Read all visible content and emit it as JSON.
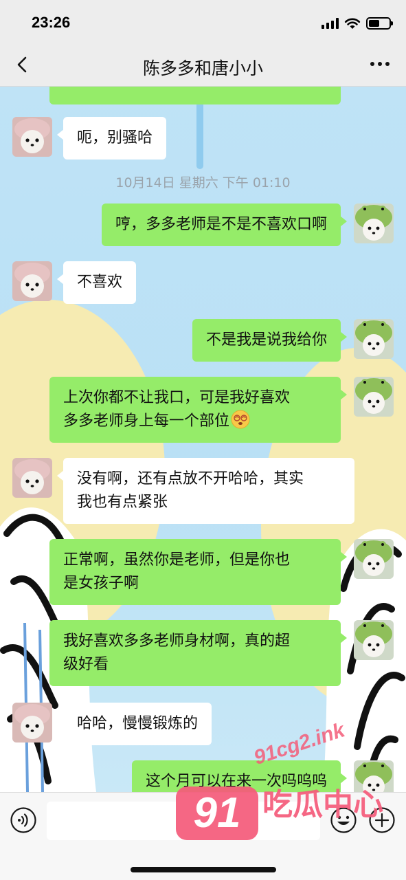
{
  "status_bar": {
    "time": "23:26",
    "battery_level": 0.55
  },
  "nav": {
    "title": "陈多多和唐小小"
  },
  "colors": {
    "outgoing_bubble": "#95ec69",
    "incoming_bubble": "#ffffff",
    "watermark": "#f45a7a"
  },
  "chat": {
    "timestamp": "10月14日 星期六 下午 01:10",
    "messages": [
      {
        "side": "in",
        "text": "呃，别骚哈"
      },
      {
        "side": "out",
        "text": "哼，多多老师是不是不喜欢口啊"
      },
      {
        "side": "in",
        "text": "不喜欢"
      },
      {
        "side": "out",
        "text": "不是我是说我给你"
      },
      {
        "side": "out",
        "line1": "上次你都不让我口，可是我好喜欢",
        "line2": "多多老师身上每一个部位",
        "emoji": "dizzy-face-emoji"
      },
      {
        "side": "in",
        "line1": "没有啊，还有点放不开哈哈，其实",
        "line2": "我也有点紧张"
      },
      {
        "side": "out",
        "line1": "正常啊，虽然你是老师，但是你也",
        "line2": "是女孩子啊"
      },
      {
        "side": "out",
        "line1": "我好喜欢多多老师身材啊，真的超",
        "line2": "级好看"
      },
      {
        "side": "in",
        "text": "哈哈，慢慢锻炼的"
      },
      {
        "side": "out",
        "text": "这个月可以在来一次吗呜呜"
      }
    ]
  },
  "input_bar": {
    "placeholder": ""
  },
  "watermark": {
    "url": "91cg2.ink",
    "number": "91",
    "label": "吃瓜中心"
  }
}
